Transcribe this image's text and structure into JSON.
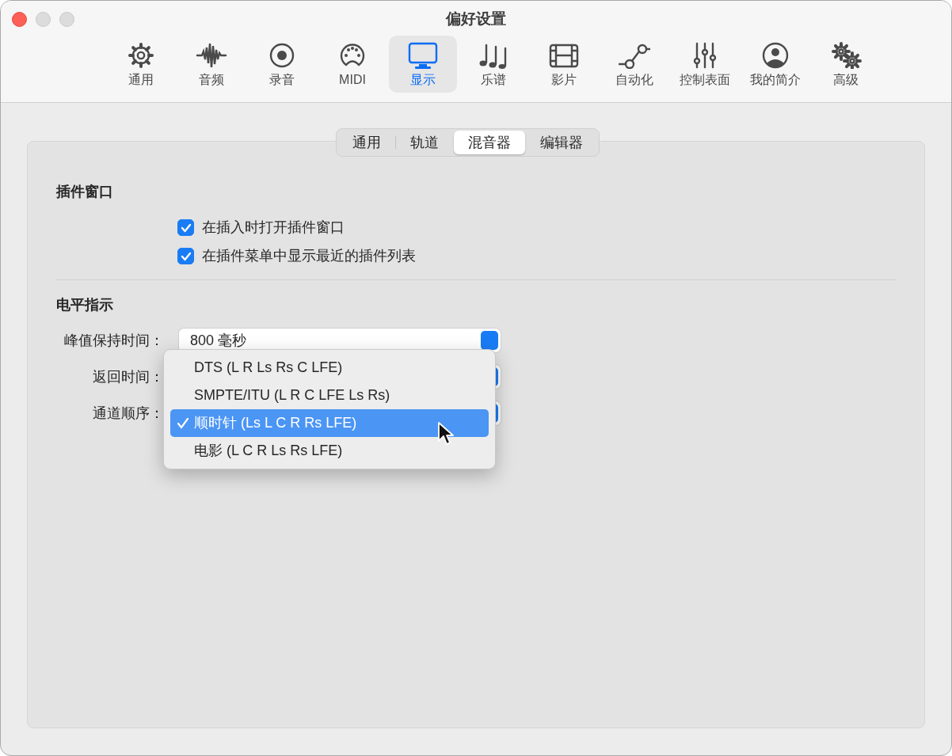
{
  "window": {
    "title": "偏好设置"
  },
  "toolbar": [
    {
      "label": "通用",
      "selected": false
    },
    {
      "label": "音频",
      "selected": false
    },
    {
      "label": "录音",
      "selected": false
    },
    {
      "label": "MIDI",
      "selected": false
    },
    {
      "label": "显示",
      "selected": true
    },
    {
      "label": "乐谱",
      "selected": false
    },
    {
      "label": "影片",
      "selected": false
    },
    {
      "label": "自动化",
      "selected": false
    },
    {
      "label": "控制表面",
      "selected": false
    },
    {
      "label": "我的简介",
      "selected": false
    },
    {
      "label": "高级",
      "selected": false
    }
  ],
  "subtabs": [
    {
      "label": "通用",
      "selected": false
    },
    {
      "label": "轨道",
      "selected": false
    },
    {
      "label": "混音器",
      "selected": true
    },
    {
      "label": "编辑器",
      "selected": false
    }
  ],
  "plugin_window": {
    "title": "插件窗口",
    "options": [
      {
        "label": "在插入时打开插件窗口",
        "checked": true
      },
      {
        "label": "在插件菜单中显示最近的插件列表",
        "checked": true
      }
    ]
  },
  "level_meters": {
    "title": "电平指示",
    "fields": [
      {
        "label": "峰值保持时间：",
        "value": "800 毫秒"
      },
      {
        "label": "返回时间："
      },
      {
        "label": "通道顺序："
      }
    ]
  },
  "popup_menu": {
    "items": [
      {
        "label": "DTS (L R Ls Rs C LFE)",
        "selected": false
      },
      {
        "label": "SMPTE/ITU (L R C LFE Ls Rs)",
        "selected": false
      },
      {
        "label": "顺时针 (Ls L C R Rs LFE)",
        "selected": true
      },
      {
        "label": "电影 (L C R Ls Rs LFE)",
        "selected": false
      }
    ]
  }
}
